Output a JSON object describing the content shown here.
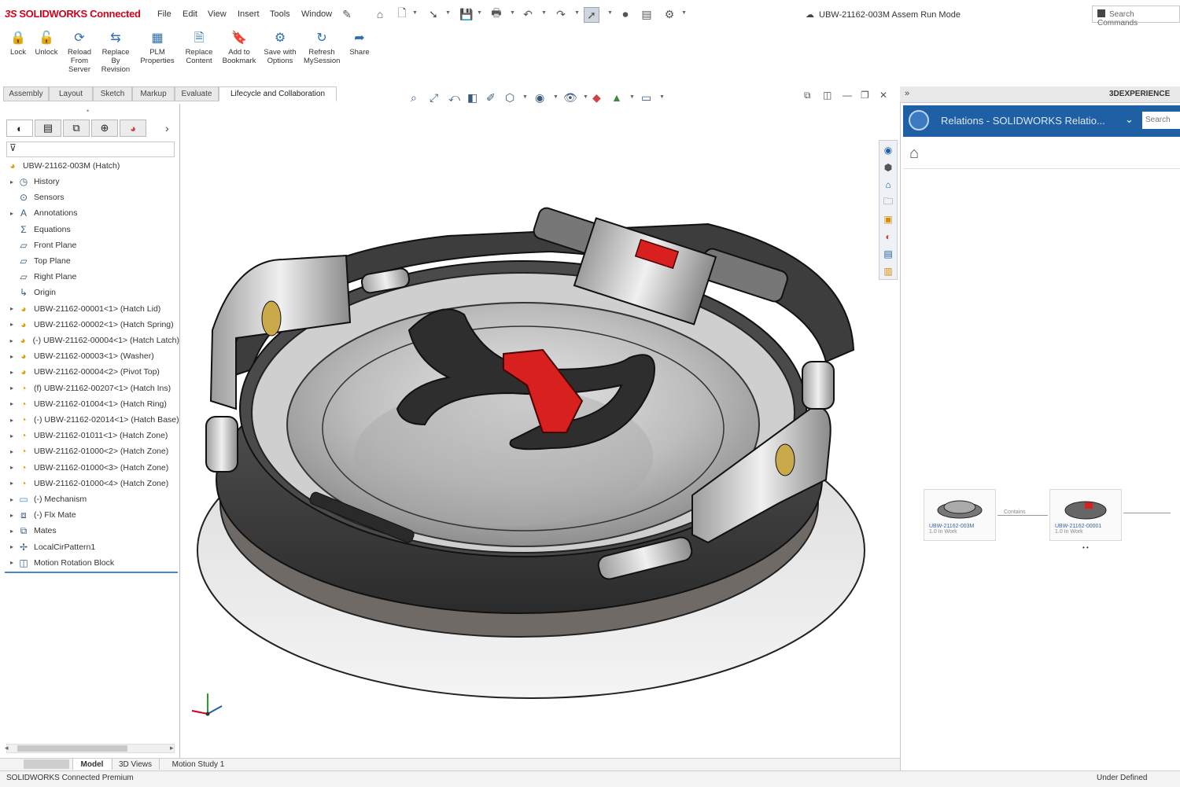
{
  "app": {
    "logo_prefix": "3S",
    "logo_text": "SOLIDWORKS Connected",
    "menu": [
      "File",
      "Edit",
      "View",
      "Insert",
      "Tools",
      "Window"
    ],
    "document_title": "UBW-21162-003M  Assem  Run Mode",
    "search_placeholder": "Search Commands"
  },
  "ribbon": {
    "buttons": [
      {
        "label": "Lock",
        "icon": "lock-icon"
      },
      {
        "label": "Unlock",
        "icon": "unlock-icon"
      },
      {
        "label": "Reload From Server",
        "icon": "reload-icon"
      },
      {
        "label": "Replace By Revision",
        "icon": "replace-icon"
      },
      {
        "label": "PLM Properties",
        "icon": "properties-icon"
      },
      {
        "label": "Replace Content",
        "icon": "content-icon"
      },
      {
        "label": "Add to Bookmark",
        "icon": "bookmark-icon"
      },
      {
        "label": "Save with Options",
        "icon": "save-options-icon"
      },
      {
        "label": "Refresh MySession",
        "icon": "refresh-icon"
      },
      {
        "label": "Share",
        "icon": "share-icon"
      }
    ]
  },
  "command_tabs": [
    "Assembly",
    "Layout",
    "Sketch",
    "Markup",
    "Evaluate",
    "Lifecycle and Collaboration"
  ],
  "active_command_tab": "Lifecycle and Collaboration",
  "feature_tree": {
    "root": "UBW-21162-003M (Hatch)",
    "items": [
      {
        "label": "History",
        "icon": "history-icon",
        "expandable": true
      },
      {
        "label": "Sensors",
        "icon": "sensor-icon",
        "expandable": false
      },
      {
        "label": "Annotations",
        "icon": "annotation-icon",
        "expandable": true
      },
      {
        "label": "Equations",
        "icon": "equation-icon",
        "expandable": false
      },
      {
        "label": "Front Plane",
        "icon": "plane-icon",
        "expandable": false
      },
      {
        "label": "Top Plane",
        "icon": "plane-icon",
        "expandable": false
      },
      {
        "label": "Right Plane",
        "icon": "plane-icon",
        "expandable": false
      },
      {
        "label": "Origin",
        "icon": "origin-icon",
        "expandable": false
      },
      {
        "label": "UBW-21162-00001<1> (Hatch Lid)",
        "icon": "part-icon",
        "expandable": true
      },
      {
        "label": "UBW-21162-00002<1> (Hatch Spring)",
        "icon": "part-icon",
        "expandable": true
      },
      {
        "label": "(-) UBW-21162-00004<1> (Hatch Latch)",
        "icon": "part-icon",
        "expandable": true
      },
      {
        "label": "UBW-21162-00003<1> (Washer)",
        "icon": "part-icon",
        "expandable": true
      },
      {
        "label": "UBW-21162-00004<2> (Pivot Top)",
        "icon": "part-icon",
        "expandable": true
      },
      {
        "label": "(f) UBW-21162-00207<1> (Hatch Ins)",
        "icon": "subassembly-icon",
        "expandable": true
      },
      {
        "label": "UBW-21162-01004<1> (Hatch Ring)",
        "icon": "subassembly-icon",
        "expandable": true
      },
      {
        "label": "(-) UBW-21162-02014<1> (Hatch Base)",
        "icon": "subassembly-icon",
        "expandable": true
      },
      {
        "label": "UBW-21162-01011<1> (Hatch Zone)",
        "icon": "subassembly-icon",
        "expandable": true
      },
      {
        "label": "UBW-21162-01000<2> (Hatch Zone)",
        "icon": "subassembly-icon",
        "expandable": true
      },
      {
        "label": "UBW-21162-01000<3> (Hatch Zone)",
        "icon": "subassembly-icon",
        "expandable": true
      },
      {
        "label": "UBW-21162-01000<4> (Hatch Zone)",
        "icon": "subassembly-icon",
        "expandable": true
      },
      {
        "label": "(-) Mechanism",
        "icon": "folder-icon",
        "expandable": true
      },
      {
        "label": "(-) Flx Mate",
        "icon": "mate-icon",
        "expandable": true
      },
      {
        "label": "Mates",
        "icon": "mates-icon",
        "expandable": true
      },
      {
        "label": "LocalCirPattern1",
        "icon": "pattern-icon",
        "expandable": true
      },
      {
        "label": "Motion Rotation Block",
        "icon": "block-icon",
        "expandable": true
      }
    ]
  },
  "bottom_tabs": [
    "Model",
    "3D Views",
    "Motion Study 1"
  ],
  "active_bottom_tab": "Model",
  "status": {
    "left": "SOLIDWORKS Connected Premium",
    "right": "Under Defined"
  },
  "right_panel": {
    "header": "3DEXPERIENCE",
    "app_title": "Relations - SOLIDWORKS Relatio...",
    "search_placeholder": "Search",
    "cards": [
      {
        "label": "UBW-21162-003M",
        "sub": "1.0 In Work"
      },
      {
        "label": "UBW-21162-00001",
        "sub": "1.0 In Work"
      }
    ],
    "relation_label": "Contains"
  },
  "colors": {
    "accent_blue": "#1f5fa3",
    "tree_active_line": "#4a86c8",
    "part_red": "#d8201e",
    "logo_red": "#d0021b"
  }
}
